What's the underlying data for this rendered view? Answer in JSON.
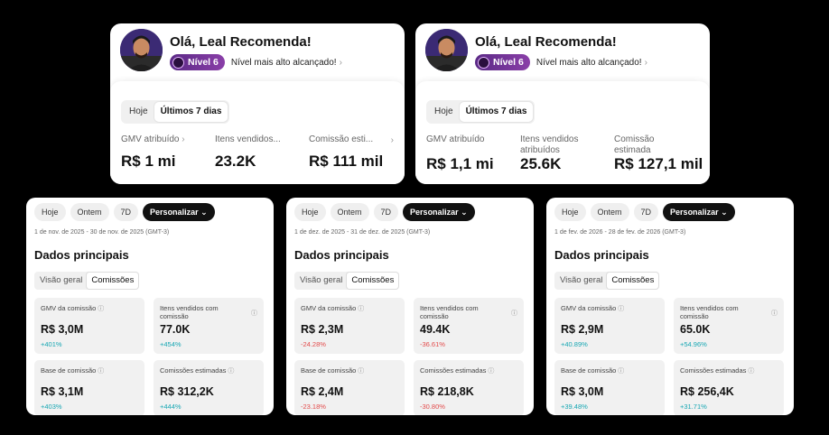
{
  "profile_cards": [
    {
      "greeting": "Olá, Leal Recomenda!",
      "level": "Nível 6",
      "level_note": "Nível mais alto alcançado!",
      "tabs": [
        "Hoje",
        "Últimos 7 dias"
      ],
      "active_tab": "Últimos 7 dias",
      "metrics": [
        {
          "label": "GMV atribuído",
          "value": "R$ 1 mi"
        },
        {
          "label": "Itens vendidos...",
          "value": "23.2K"
        },
        {
          "label": "Comissão esti...",
          "value": "R$ 111 mil"
        }
      ]
    },
    {
      "greeting": "Olá, Leal Recomenda!",
      "level": "Nível 6",
      "level_note": "Nível mais alto alcançado!",
      "tabs": [
        "Hoje",
        "Últimos 7 dias"
      ],
      "active_tab": "Últimos 7 dias",
      "metrics": [
        {
          "label": "GMV atribuído",
          "value": "R$ 1,1 mi"
        },
        {
          "label": "Itens vendidos atribuídos",
          "value": "25.6K"
        },
        {
          "label": "Comissão estimada",
          "value": "R$ 127,1 mil"
        }
      ]
    }
  ],
  "panels": [
    {
      "chips": [
        "Hoje",
        "Ontem",
        "7D",
        "Personalizar"
      ],
      "date_range": "1 de nov. de 2025 - 30 de nov. de 2025 (GMT-3)",
      "title": "Dados principais",
      "tabs": [
        "Visão geral",
        "Comissões"
      ],
      "active_tab": "Comissões",
      "stats": [
        {
          "label": "GMV da comissão",
          "value": "R$ 3,0M",
          "change": "+401%",
          "trend": "up"
        },
        {
          "label": "Itens vendidos com comissão",
          "value": "77.0K",
          "change": "+454%",
          "trend": "up"
        },
        {
          "label": "Base de comissão",
          "value": "R$ 3,1M",
          "change": "+403%",
          "trend": "up"
        },
        {
          "label": "Comissões estimadas",
          "value": "R$ 312,2K",
          "change": "+444%",
          "trend": "up"
        }
      ]
    },
    {
      "chips": [
        "Hoje",
        "Ontem",
        "7D",
        "Personalizar"
      ],
      "date_range": "1 de dez. de 2025 - 31 de dez. de 2025 (GMT-3)",
      "title": "Dados principais",
      "tabs": [
        "Visão geral",
        "Comissões"
      ],
      "active_tab": "Comissões",
      "stats": [
        {
          "label": "GMV da comissão",
          "value": "R$ 2,3M",
          "change": "-24.28%",
          "trend": "down"
        },
        {
          "label": "Itens vendidos com comissão",
          "value": "49.4K",
          "change": "-36.61%",
          "trend": "down"
        },
        {
          "label": "Base de comissão",
          "value": "R$ 2,4M",
          "change": "-23.18%",
          "trend": "down"
        },
        {
          "label": "Comissões estimadas",
          "value": "R$ 218,8K",
          "change": "-30.80%",
          "trend": "down"
        }
      ]
    },
    {
      "chips": [
        "Hoje",
        "Ontem",
        "7D",
        "Personalizar"
      ],
      "date_range": "1 de fev. de 2026 - 28 de fev. de 2026 (GMT-3)",
      "title": "Dados principais",
      "tabs": [
        "Visão geral",
        "Comissões"
      ],
      "active_tab": "Comissões",
      "stats": [
        {
          "label": "GMV da comissão",
          "value": "R$ 2,9M",
          "change": "+40.89%",
          "trend": "up"
        },
        {
          "label": "Itens vendidos com comissão",
          "value": "65.0K",
          "change": "+54.96%",
          "trend": "up"
        },
        {
          "label": "Base de comissão",
          "value": "R$ 3,0M",
          "change": "+39.48%",
          "trend": "up"
        },
        {
          "label": "Comissões estimadas",
          "value": "R$ 256,4K",
          "change": "+31.71%",
          "trend": "up"
        }
      ]
    }
  ],
  "colors": {
    "background": "#000000",
    "up": "#17a7b3",
    "down": "#e34b4b",
    "level_badge": "#6b2f92"
  }
}
